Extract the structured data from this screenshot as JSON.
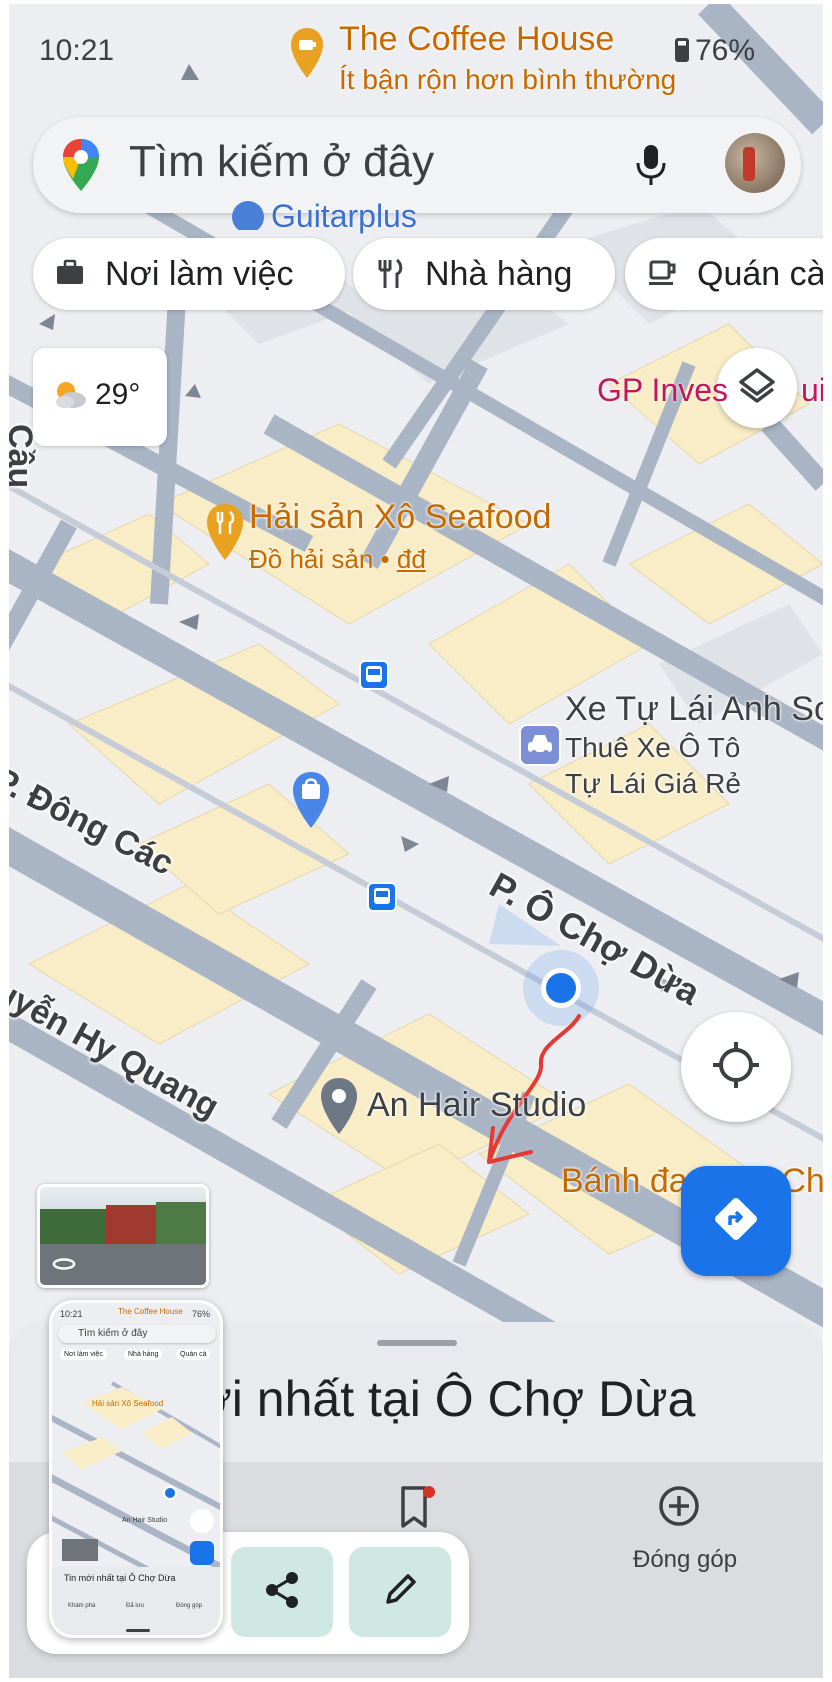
{
  "status_bar": {
    "time": "10:21",
    "battery": "76%"
  },
  "top_poi": {
    "name": "The Coffee House",
    "subtitle": "Ít bận rộn hơn bình thường"
  },
  "search": {
    "placeholder": "Tìm kiếm ở đây"
  },
  "chips": [
    {
      "label": "Nơi làm việc",
      "icon": "briefcase-icon"
    },
    {
      "label": "Nhà hàng",
      "icon": "fork-knife-icon"
    },
    {
      "label": "Quán cà",
      "icon": "coffee-cup-icon"
    }
  ],
  "weather": {
    "temperature": "29°",
    "icon": "partly-cloudy-icon"
  },
  "map_labels": {
    "guitarplus": "Guitarplus",
    "gp_invest": "GP Inves",
    "gp_invest_tail": "uild",
    "seafood_name": "Hải sản Xô Seafood",
    "seafood_sub": "Đồ hải sản • ",
    "seafood_price": "đđ",
    "car_rental_name": "Xe Tự Lái Anh So",
    "car_rental_line1": "Thuê Xe Ô Tô",
    "car_rental_line2": "Tự Lái Giá Rẻ",
    "street_o_cho_dua": "P. Ô Chợ Dừa",
    "street_dong_cac": "P. Đông Các",
    "street_hy_quang": "uyễn Hy Quang",
    "street_left": "Cầu",
    "hair_studio": "An Hair Studio",
    "banh_da": "Bánh đa N",
    "banh_da_tail": "a Ch"
  },
  "bottom_sheet": {
    "title": "ới nhất tại Ô Chợ Dừa"
  },
  "bottom_nav": {
    "contribute_label": "Đóng góp"
  },
  "thumbnail": {
    "time": "10:21",
    "battery": "76%",
    "search": "Tìm kiếm ở đây",
    "chip1": "Nơi làm việc",
    "chip2": "Nhà hàng",
    "chip3": "Quán cà",
    "coffee": "The Coffee House",
    "seafood": "Hải sản Xô Seafood",
    "hair": "An Hair Studio",
    "sheet_title": "Tin mới nhất tại Ô Chợ Dừa",
    "nav1": "Khám phá",
    "nav2": "Đã lưu",
    "nav3": "Đóng góp"
  },
  "colors": {
    "accent_blue": "#1a73e8",
    "poi_orange": "#c66a00",
    "poi_pink": "#c2185b",
    "annotation_red": "#e53935"
  }
}
